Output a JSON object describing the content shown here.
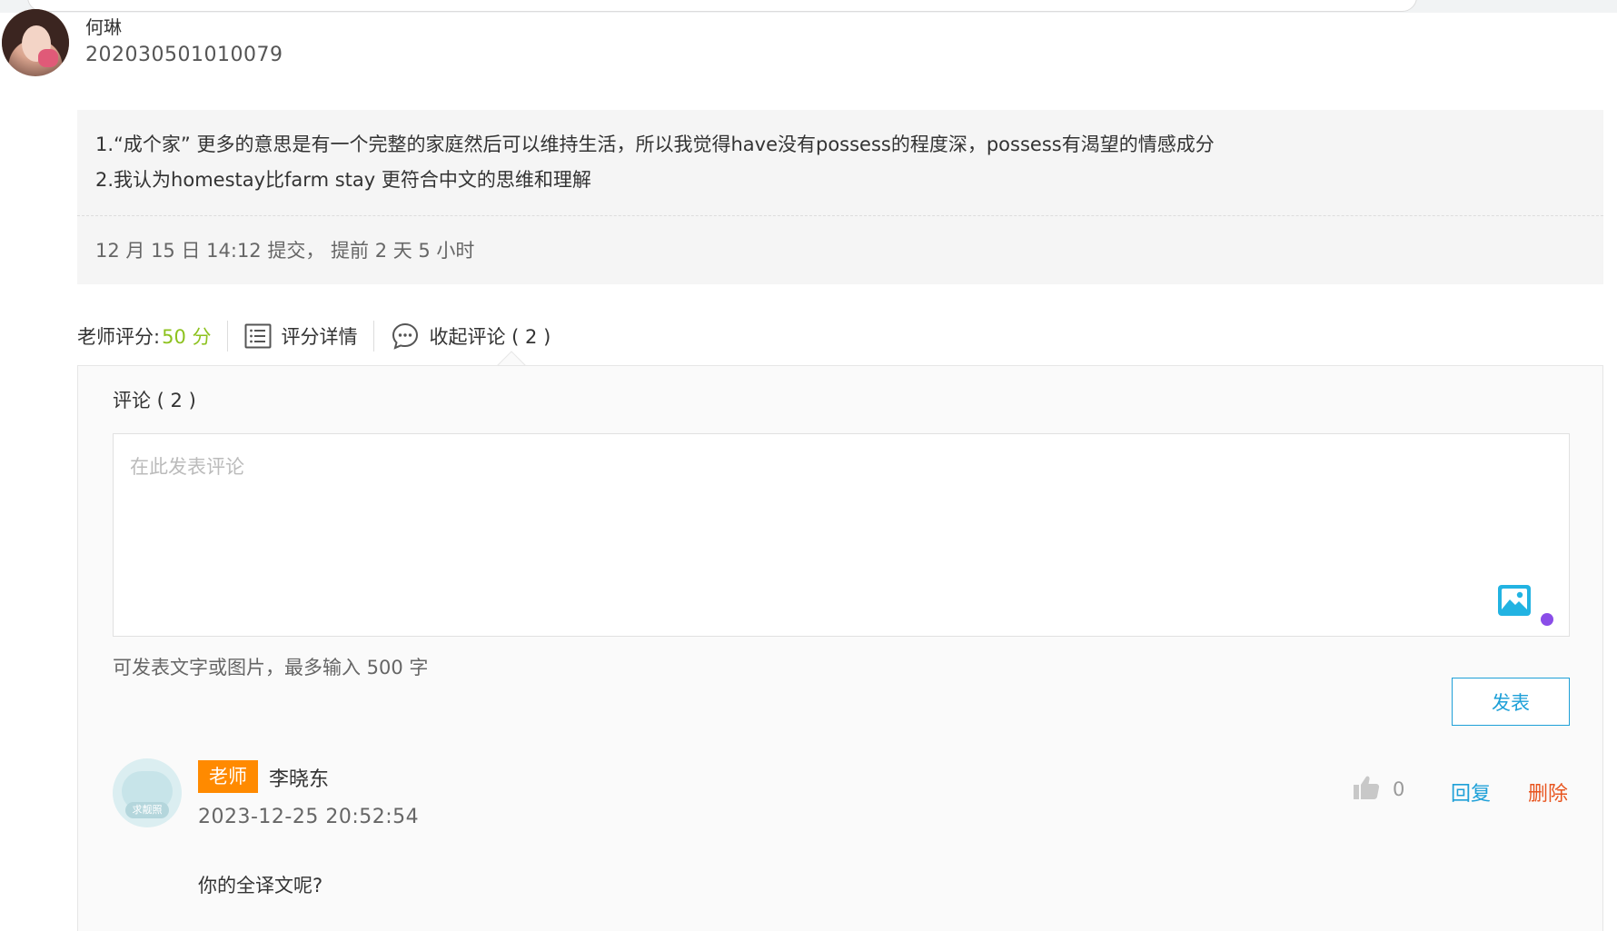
{
  "student": {
    "name": "何琳",
    "id": "202030501010079"
  },
  "answer": {
    "line1": "1.“成个家” 更多的意思是有一个完整的家庭然后可以维持生活，所以我觉得have没有possess的程度深，possess有渴望的情感成分",
    "line2": "2.我认为homestay比farm stay 更符合中文的思维和理解",
    "submit_time": "12 月 15 日 14:12 提交， 提前 2 天 5 小时"
  },
  "actions": {
    "score_label": "老师评分:",
    "score_value": "50 分",
    "grading_details": "评分详情",
    "collapse_comments": "收起评论 ( 2 )"
  },
  "comments": {
    "title": "评论 ( 2 )",
    "placeholder": "在此发表评论",
    "hint": "可发表文字或图片，最多输入 500 字",
    "publish_label": "发表",
    "items": [
      {
        "role_badge": "老师",
        "author": "李晓东",
        "avatar_caption": "求靓照",
        "time": "2023-12-25 20:52:54",
        "likes": "0",
        "reply_label": "回复",
        "delete_label": "删除",
        "body": "你的全译文呢?"
      }
    ]
  },
  "colors": {
    "accent_blue": "#1ea0d8",
    "score_green": "#8dc21f",
    "badge_orange": "#ff8a00",
    "delete_red": "#e8541e"
  },
  "icons": [
    "list-icon",
    "chat-bubble-icon",
    "image-icon",
    "thumbs-up-icon"
  ]
}
